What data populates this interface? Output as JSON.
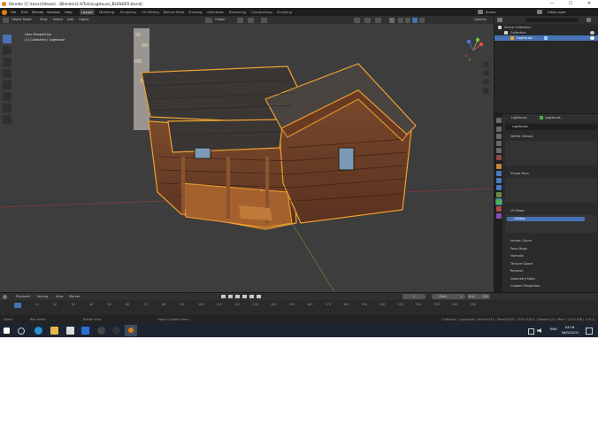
{
  "window": {
    "title": "Blender [C:\\Users\\Steam\\...\\Blender\\2.9\\Tuts\\LogHouse_BLENDER.blend]",
    "controls": [
      "—",
      "☐",
      "✕"
    ]
  },
  "topbar": {
    "menus": [
      "File",
      "Edit",
      "Render",
      "Window",
      "Help"
    ],
    "workspaces": [
      "Layout",
      "Modeling",
      "Sculpting",
      "UV Editing",
      "Texture Paint",
      "Shading",
      "Animation",
      "Rendering",
      "Compositing",
      "Scripting"
    ],
    "active_workspace": "Layout",
    "scene_label": "Scene",
    "viewlayer_label": "View Layer"
  },
  "viewport_header": {
    "mode": "Object Mode",
    "menus": [
      "View",
      "Select",
      "Add",
      "Object"
    ],
    "transform": "Global",
    "options_label": "Options"
  },
  "viewport": {
    "info_line1": "User Perspective",
    "info_line2": "(1) Collection | LogHouse"
  },
  "outliner": {
    "title": "Scene Collection",
    "rows": [
      "Collection",
      "LogHouse"
    ]
  },
  "properties": {
    "object_name": "LogHouse",
    "mesh_name": "LogHouse",
    "sections": {
      "vertex_groups": "Vertex Groups",
      "shape_keys": "Shape Keys",
      "uv_maps": "UV Maps",
      "uv_map_item": "UVMap"
    },
    "collapsed_sections": [
      "Vertex Colors",
      "Face Maps",
      "Normals",
      "Texture Space",
      "Remesh",
      "Geometry Data",
      "Custom Properties"
    ]
  },
  "timeline": {
    "menus": [
      "Playback",
      "Keying",
      "View",
      "Marker"
    ],
    "current_frame": "1",
    "start_label": "Start",
    "start_value": "1",
    "end_label": "End",
    "end_value": "250",
    "ticks": [
      "0",
      "10",
      "20",
      "30",
      "40",
      "50",
      "60",
      "70",
      "80",
      "90",
      "100",
      "110",
      "120",
      "130",
      "140",
      "150",
      "160",
      "170",
      "180",
      "190",
      "200",
      "210",
      "220",
      "230",
      "240",
      "250"
    ]
  },
  "statusbar": {
    "left_items": [
      "Select",
      "Box Select",
      "Rotate View",
      "Object Context Menu"
    ],
    "right_text": "Collection | LogHouse | Verts:5,911 | Faces:5,827 | Tris:10,812 | Objects:1/1 | Mem: 114.9 MiB | 2.91.0"
  },
  "taskbar": {
    "time": "04:16",
    "date": "08/02/2021",
    "lang": "ENG"
  },
  "colors": {
    "accent": "#4772b3",
    "selection_outline": "#f0a030",
    "blender_orange": "#e87d0d"
  }
}
